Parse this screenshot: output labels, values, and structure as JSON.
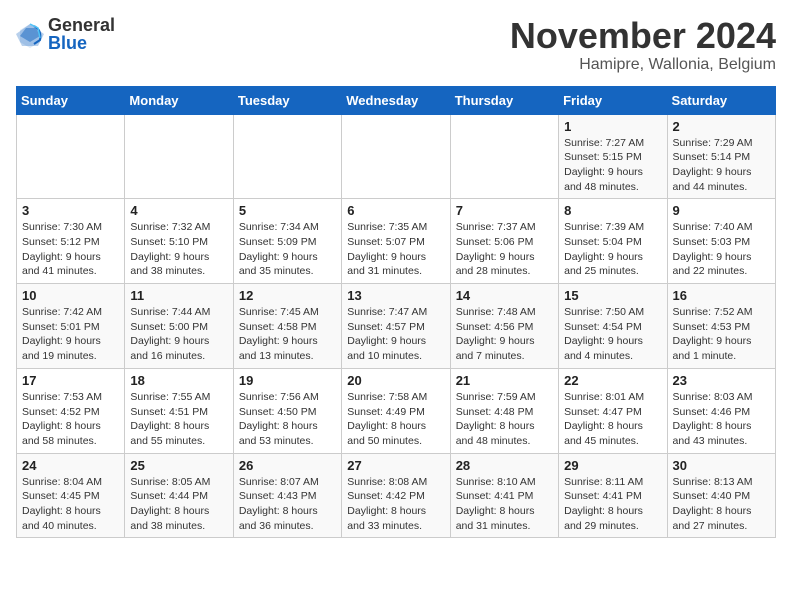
{
  "logo": {
    "general": "General",
    "blue": "Blue"
  },
  "header": {
    "month": "November 2024",
    "location": "Hamipre, Wallonia, Belgium"
  },
  "weekdays": [
    "Sunday",
    "Monday",
    "Tuesday",
    "Wednesday",
    "Thursday",
    "Friday",
    "Saturday"
  ],
  "weeks": [
    [
      {
        "day": "",
        "info": ""
      },
      {
        "day": "",
        "info": ""
      },
      {
        "day": "",
        "info": ""
      },
      {
        "day": "",
        "info": ""
      },
      {
        "day": "",
        "info": ""
      },
      {
        "day": "1",
        "info": "Sunrise: 7:27 AM\nSunset: 5:15 PM\nDaylight: 9 hours and 48 minutes."
      },
      {
        "day": "2",
        "info": "Sunrise: 7:29 AM\nSunset: 5:14 PM\nDaylight: 9 hours and 44 minutes."
      }
    ],
    [
      {
        "day": "3",
        "info": "Sunrise: 7:30 AM\nSunset: 5:12 PM\nDaylight: 9 hours and 41 minutes."
      },
      {
        "day": "4",
        "info": "Sunrise: 7:32 AM\nSunset: 5:10 PM\nDaylight: 9 hours and 38 minutes."
      },
      {
        "day": "5",
        "info": "Sunrise: 7:34 AM\nSunset: 5:09 PM\nDaylight: 9 hours and 35 minutes."
      },
      {
        "day": "6",
        "info": "Sunrise: 7:35 AM\nSunset: 5:07 PM\nDaylight: 9 hours and 31 minutes."
      },
      {
        "day": "7",
        "info": "Sunrise: 7:37 AM\nSunset: 5:06 PM\nDaylight: 9 hours and 28 minutes."
      },
      {
        "day": "8",
        "info": "Sunrise: 7:39 AM\nSunset: 5:04 PM\nDaylight: 9 hours and 25 minutes."
      },
      {
        "day": "9",
        "info": "Sunrise: 7:40 AM\nSunset: 5:03 PM\nDaylight: 9 hours and 22 minutes."
      }
    ],
    [
      {
        "day": "10",
        "info": "Sunrise: 7:42 AM\nSunset: 5:01 PM\nDaylight: 9 hours and 19 minutes."
      },
      {
        "day": "11",
        "info": "Sunrise: 7:44 AM\nSunset: 5:00 PM\nDaylight: 9 hours and 16 minutes."
      },
      {
        "day": "12",
        "info": "Sunrise: 7:45 AM\nSunset: 4:58 PM\nDaylight: 9 hours and 13 minutes."
      },
      {
        "day": "13",
        "info": "Sunrise: 7:47 AM\nSunset: 4:57 PM\nDaylight: 9 hours and 10 minutes."
      },
      {
        "day": "14",
        "info": "Sunrise: 7:48 AM\nSunset: 4:56 PM\nDaylight: 9 hours and 7 minutes."
      },
      {
        "day": "15",
        "info": "Sunrise: 7:50 AM\nSunset: 4:54 PM\nDaylight: 9 hours and 4 minutes."
      },
      {
        "day": "16",
        "info": "Sunrise: 7:52 AM\nSunset: 4:53 PM\nDaylight: 9 hours and 1 minute."
      }
    ],
    [
      {
        "day": "17",
        "info": "Sunrise: 7:53 AM\nSunset: 4:52 PM\nDaylight: 8 hours and 58 minutes."
      },
      {
        "day": "18",
        "info": "Sunrise: 7:55 AM\nSunset: 4:51 PM\nDaylight: 8 hours and 55 minutes."
      },
      {
        "day": "19",
        "info": "Sunrise: 7:56 AM\nSunset: 4:50 PM\nDaylight: 8 hours and 53 minutes."
      },
      {
        "day": "20",
        "info": "Sunrise: 7:58 AM\nSunset: 4:49 PM\nDaylight: 8 hours and 50 minutes."
      },
      {
        "day": "21",
        "info": "Sunrise: 7:59 AM\nSunset: 4:48 PM\nDaylight: 8 hours and 48 minutes."
      },
      {
        "day": "22",
        "info": "Sunrise: 8:01 AM\nSunset: 4:47 PM\nDaylight: 8 hours and 45 minutes."
      },
      {
        "day": "23",
        "info": "Sunrise: 8:03 AM\nSunset: 4:46 PM\nDaylight: 8 hours and 43 minutes."
      }
    ],
    [
      {
        "day": "24",
        "info": "Sunrise: 8:04 AM\nSunset: 4:45 PM\nDaylight: 8 hours and 40 minutes."
      },
      {
        "day": "25",
        "info": "Sunrise: 8:05 AM\nSunset: 4:44 PM\nDaylight: 8 hours and 38 minutes."
      },
      {
        "day": "26",
        "info": "Sunrise: 8:07 AM\nSunset: 4:43 PM\nDaylight: 8 hours and 36 minutes."
      },
      {
        "day": "27",
        "info": "Sunrise: 8:08 AM\nSunset: 4:42 PM\nDaylight: 8 hours and 33 minutes."
      },
      {
        "day": "28",
        "info": "Sunrise: 8:10 AM\nSunset: 4:41 PM\nDaylight: 8 hours and 31 minutes."
      },
      {
        "day": "29",
        "info": "Sunrise: 8:11 AM\nSunset: 4:41 PM\nDaylight: 8 hours and 29 minutes."
      },
      {
        "day": "30",
        "info": "Sunrise: 8:13 AM\nSunset: 4:40 PM\nDaylight: 8 hours and 27 minutes."
      }
    ]
  ]
}
